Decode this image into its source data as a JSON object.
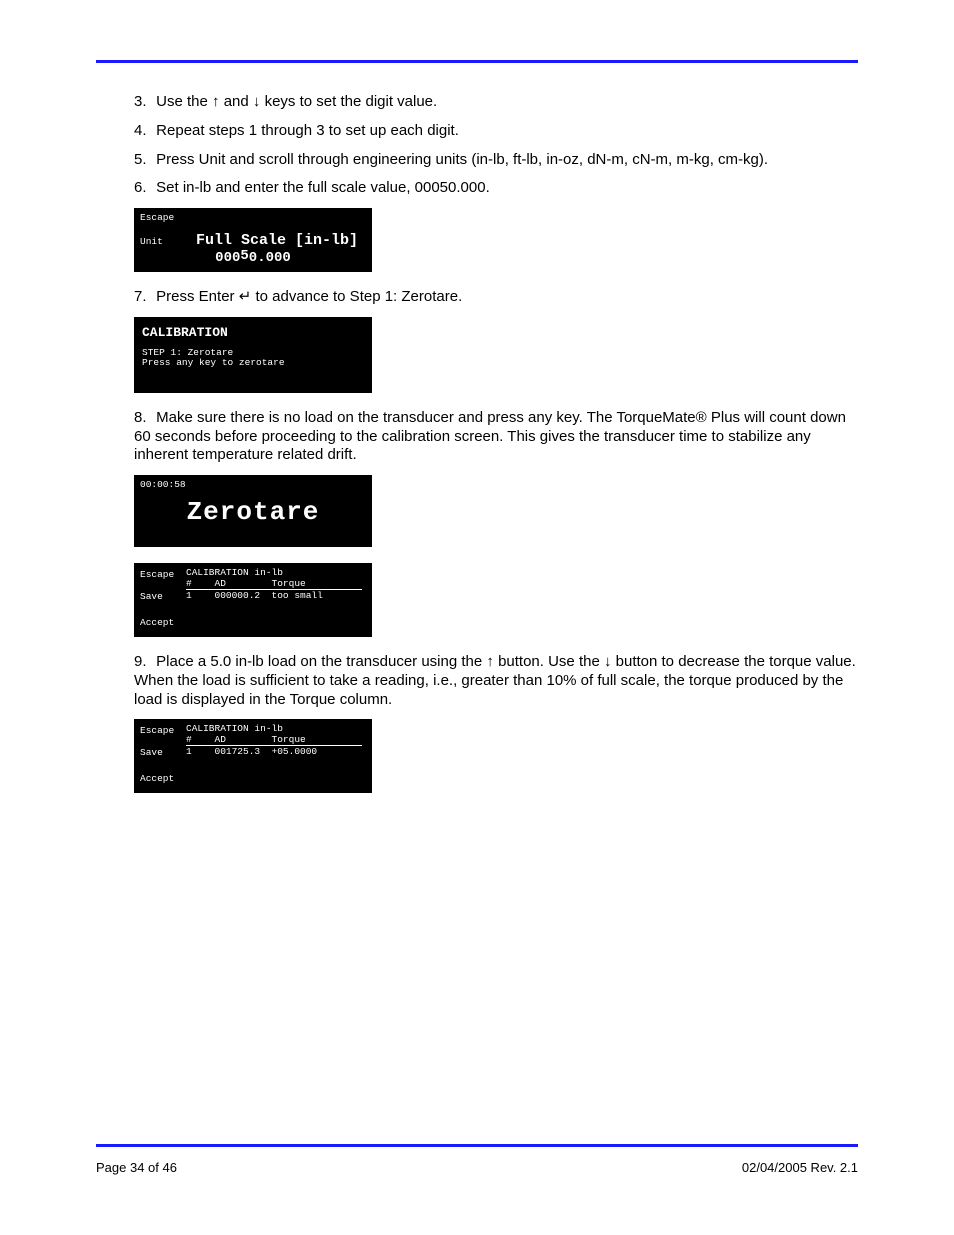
{
  "step3": {
    "num": "3.",
    "text_a": "Use the ",
    "up": "↑",
    "text_mid": " and ",
    "down": "↓",
    "text_b": " keys to set the digit value."
  },
  "step4": {
    "num": "4.",
    "text": "Repeat steps 1 through 3 to set up each digit."
  },
  "step5": {
    "num": "5.",
    "text": "Press Unit and scroll through engineering units (in-lb, ft-lb, in-oz, dN-m, cN-m, m-kg, cm-kg)."
  },
  "step6": {
    "num": "6.",
    "text": "Set in-lb and enter the full scale value, 00050.000."
  },
  "crt1": {
    "escape": "Escape",
    "unit": "Unit",
    "title": "Full Scale [in-lb]",
    "value_left": "000",
    "value_cursor_char": "5",
    "value_right": "0.000"
  },
  "step7": {
    "num": "7.",
    "prefix": "Press Enter ",
    "enter_sym": "↵",
    "suffix": " to advance to Step 1: Zerotare."
  },
  "crt2": {
    "hdr": "CALIBRATION",
    "l1": "STEP 1: Zerotare",
    "l2": "Press any key to zerotare"
  },
  "step8": {
    "num": "8.",
    "text": "Make sure there is no load on the transducer and press any key. The TorqueMate® Plus will count down 60 seconds before proceeding to the calibration screen. This gives the transducer time to stabilize any inherent temperature related drift."
  },
  "crt3": {
    "time": "00:00:58",
    "big": "Zerotare"
  },
  "crt4": {
    "hdr": "CALIBRATION in-lb",
    "cols": "#    AD        Torque",
    "row": "1    000000.2  too small",
    "escape": "Escape",
    "save": "Save",
    "accept": "Accept"
  },
  "step9": {
    "num": "9.",
    "a": "Place a 5.0 in-lb load on the transducer using the ",
    "up": "↑",
    "mid": " button. Use the ",
    "down": "↓",
    "b": " button to decrease the torque value. When the load is sufficient to take a reading, i.e., greater than 10% of full scale, the torque produced by the load is displayed in the Torque column."
  },
  "crt5": {
    "hdr": "CALIBRATION in-lb",
    "cols": "#    AD        Torque",
    "row": "1    001725.3  +05.0000",
    "escape": "Escape",
    "save": "Save",
    "accept": "Accept"
  },
  "footer": {
    "left": "Page 34 of 46",
    "right": "02/04/2005  Rev. 2.1"
  }
}
